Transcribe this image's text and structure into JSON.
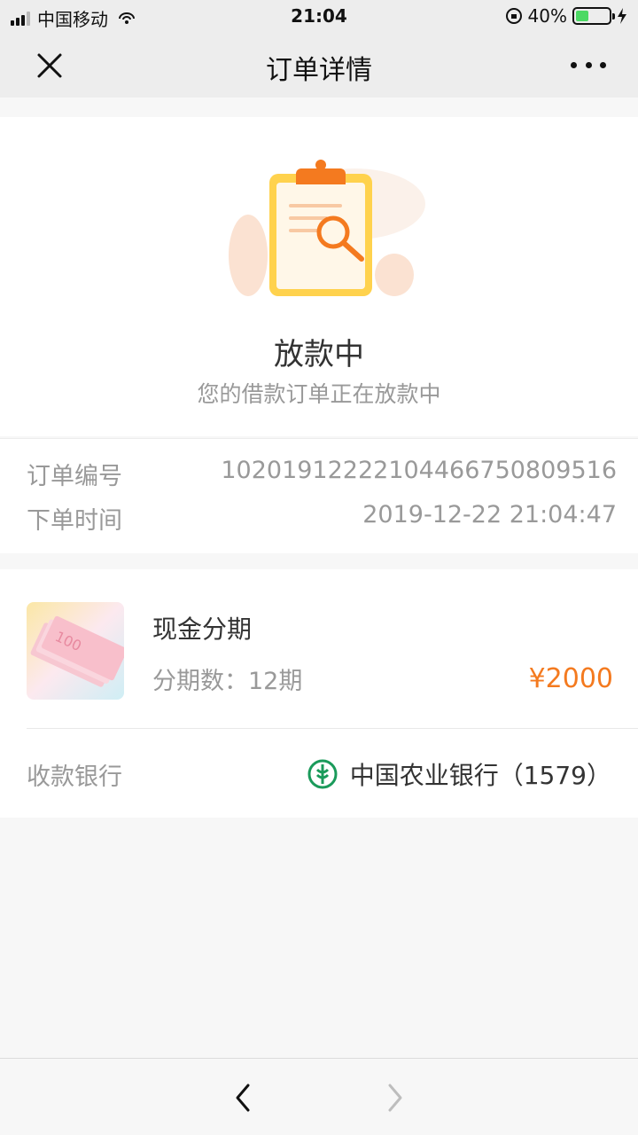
{
  "status_bar": {
    "carrier": "中国移动",
    "time": "21:04",
    "battery_percent": "40%",
    "battery_level": 0.4
  },
  "nav": {
    "title": "订单详情"
  },
  "status": {
    "title": "放款中",
    "subtitle": "您的借款订单正在放款中"
  },
  "order": {
    "number_label": "订单编号",
    "number": "1020191222210446675080951 6",
    "time_label": "下单时间",
    "time": "2019-12-22 21:04:47"
  },
  "product": {
    "name": "现金分期",
    "period": "分期数：12期",
    "price": "¥2000",
    "price_color": "#f47a1f"
  },
  "bank": {
    "label": "收款银行",
    "name": "中国农业银行（1579）",
    "icon_color": "#1a9a5a"
  },
  "colors": {
    "accent": "#f47a1f",
    "page_bg": "#f7f7f7",
    "nav_bg": "#ededed"
  }
}
